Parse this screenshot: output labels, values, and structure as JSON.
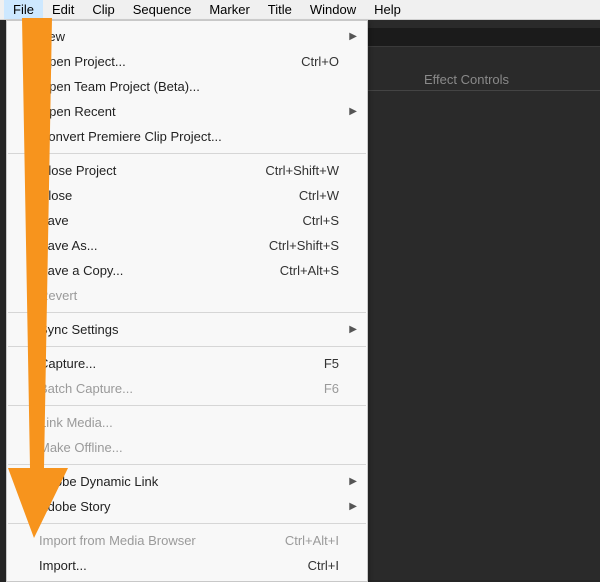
{
  "menubar": {
    "items": [
      "File",
      "Edit",
      "Clip",
      "Sequence",
      "Marker",
      "Title",
      "Window",
      "Help"
    ]
  },
  "panel": {
    "tab_label": "Effect Controls"
  },
  "file_menu": {
    "groups": [
      [
        {
          "label": "New",
          "submenu": true
        },
        {
          "label": "Open Project...",
          "shortcut": "Ctrl+O"
        },
        {
          "label": "Open Team Project (Beta)..."
        },
        {
          "label": "Open Recent",
          "submenu": true
        },
        {
          "label": "Convert Premiere Clip Project..."
        }
      ],
      [
        {
          "label": "Close Project",
          "shortcut": "Ctrl+Shift+W"
        },
        {
          "label": "Close",
          "shortcut": "Ctrl+W"
        },
        {
          "label": "Save",
          "shortcut": "Ctrl+S"
        },
        {
          "label": "Save As...",
          "shortcut": "Ctrl+Shift+S"
        },
        {
          "label": "Save a Copy...",
          "shortcut": "Ctrl+Alt+S"
        },
        {
          "label": "Revert",
          "disabled": true
        }
      ],
      [
        {
          "label": "Sync Settings",
          "submenu": true
        }
      ],
      [
        {
          "label": "Capture...",
          "shortcut": "F5"
        },
        {
          "label": "Batch Capture...",
          "shortcut": "F6",
          "disabled": true
        }
      ],
      [
        {
          "label": "Link Media...",
          "disabled": true
        },
        {
          "label": "Make Offline...",
          "disabled": true
        }
      ],
      [
        {
          "label": "Adobe Dynamic Link",
          "submenu": true
        },
        {
          "label": "Adobe Story",
          "submenu": true
        }
      ],
      [
        {
          "label": "Import from Media Browser",
          "shortcut": "Ctrl+Alt+I",
          "disabled": true
        },
        {
          "label": "Import...",
          "shortcut": "Ctrl+I"
        }
      ]
    ]
  },
  "annotation": {
    "arrow_color": "#f7941d"
  }
}
